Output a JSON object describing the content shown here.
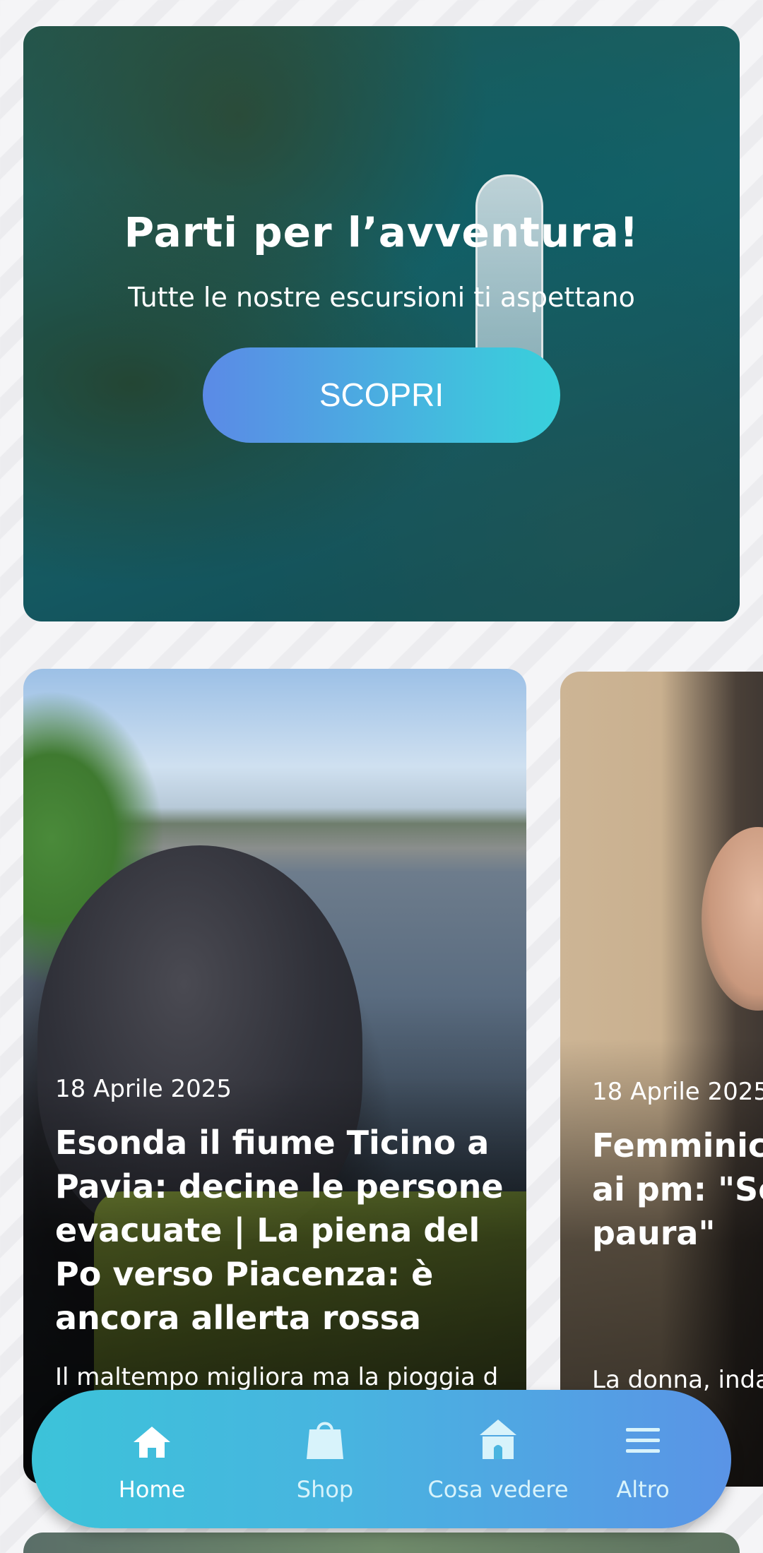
{
  "hero": {
    "title": "Parti per l’avventura!",
    "subtitle": "Tutte le nostre escursioni ti aspettano",
    "button_label": "SCOPRI"
  },
  "news": [
    {
      "date": "18 Aprile 2025",
      "title": "Esonda il fiume Ticino a Pavia: decine le persone evacuate | La piena del Po verso Piacenza: è ancora allerta rossa",
      "excerpt": "Il maltempo migliora ma la pioggia d"
    },
    {
      "date": "18 Aprile 2025",
      "title": "Femminicio la madre d ai pm: \"Se demonio, h paura\"",
      "excerpt": "La donna, inda ... amen ... ato"
    }
  ],
  "nav": {
    "items": [
      {
        "label": "Home",
        "icon": "home-icon",
        "active": true
      },
      {
        "label": "Shop",
        "icon": "shopping-bag-icon",
        "active": false
      },
      {
        "label": "Cosa vedere",
        "icon": "landmark-icon",
        "active": false
      },
      {
        "label": "Altro",
        "icon": "menu-icon",
        "active": false
      }
    ]
  },
  "colors": {
    "accent_start": "#5b8ae6",
    "accent_end": "#38d0dc",
    "nav_active": "#ffffff",
    "nav_inactive": "#d8f3fb"
  }
}
